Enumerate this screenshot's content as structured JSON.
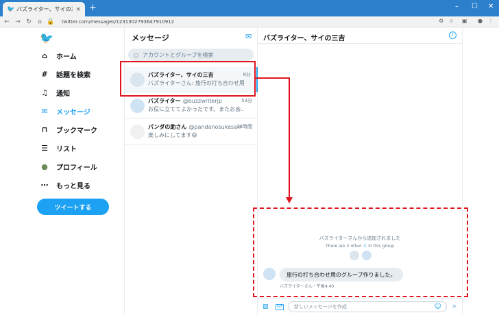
{
  "browser": {
    "tab_title": "バズライター、サイの三吉 / Twitter",
    "tab_close": "×",
    "new_tab": "+",
    "url": "twitter.com/messages/1231302793647910912",
    "window_controls": [
      "–",
      "☐",
      "✕"
    ]
  },
  "nav": {
    "items": [
      {
        "label": "ホーム",
        "icon": "home-icon",
        "glyph": "⌂"
      },
      {
        "label": "話題を検索",
        "icon": "hashtag-icon",
        "glyph": "#"
      },
      {
        "label": "通知",
        "icon": "bell-icon",
        "glyph": "♫"
      },
      {
        "label": "メッセージ",
        "icon": "mail-icon",
        "glyph": "✉"
      },
      {
        "label": "ブックマーク",
        "icon": "bookmark-icon",
        "glyph": "⊓"
      },
      {
        "label": "リスト",
        "icon": "list-icon",
        "glyph": "☰"
      },
      {
        "label": "プロフィール",
        "icon": "avatar-icon",
        "glyph": "●"
      },
      {
        "label": "もっと見る",
        "icon": "more-icon",
        "glyph": "⋯"
      }
    ],
    "active": "メッセージ",
    "tweet_button": "ツイートする"
  },
  "messages": {
    "title": "メッセージ",
    "search_placeholder": "アカウントとグループを検索",
    "conversations": [
      {
        "name": "バズライター、サイの三吉",
        "handle": "",
        "time": "8分",
        "snippet": "バズライターさん: 旅行の打ち合わせ用...",
        "selected": true
      },
      {
        "name": "バズライター",
        "handle": "@buzzwriterjp",
        "time": "53分",
        "snippet": "お役に立ててよかったです。またお会...",
        "selected": false
      },
      {
        "name": "パンダの助さん",
        "handle": "@pandanosukesan",
        "time": "18時間",
        "snippet": "楽しみにしてます😄",
        "selected": false
      }
    ]
  },
  "chat": {
    "title": "バズライター、サイの三吉",
    "system_added": "バズライターさんから追加されました",
    "system_group_prefix": "There are 2 other ",
    "system_group_link": "人",
    "system_group_suffix": " in this group",
    "message_text": "旅行の打ち合わせ用のグループ作りました。",
    "message_meta": "バズライターさん・午後4:40",
    "composer_placeholder": "新しいメッセージを作成"
  },
  "colors": {
    "accent": "#1da1f2",
    "annotation": "#e0141e"
  }
}
